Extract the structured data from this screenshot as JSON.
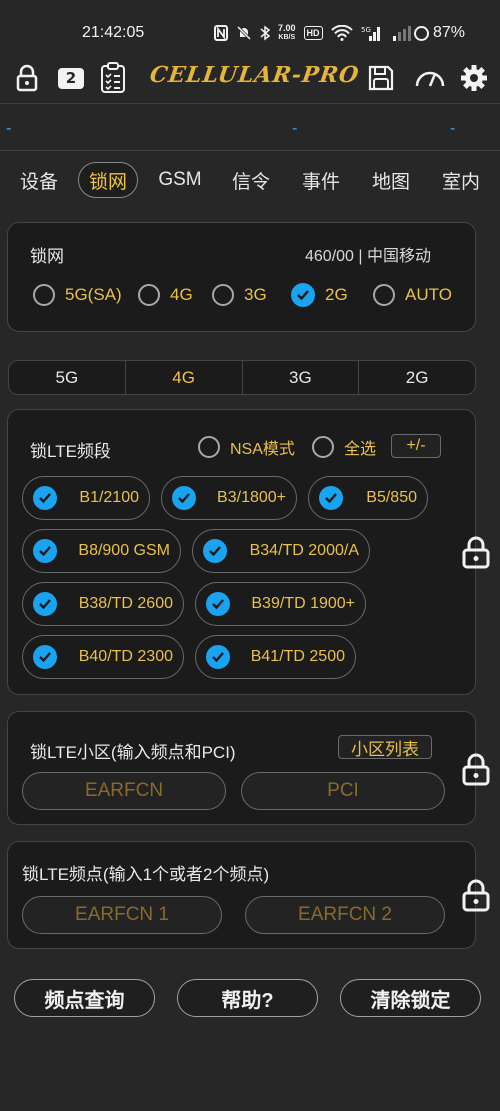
{
  "status_bar": {
    "time": "21:42:05",
    "speed_value": "7.00",
    "speed_unit": "KB/S",
    "hd_label": "HD",
    "battery": "87%"
  },
  "toolbar": {
    "badge_count": "2",
    "app_title": "CELLULAR-PRO"
  },
  "info_dashes": [
    "-",
    "-",
    "-"
  ],
  "tabs": [
    "设备",
    "锁网",
    "GSM",
    "信令",
    "事件",
    "地图",
    "室内"
  ],
  "active_tab": "锁网",
  "lock_network": {
    "title": "锁网",
    "operator": "460/00 | 中国移动",
    "options": [
      "5G(SA)",
      "4G",
      "3G",
      "2G",
      "AUTO"
    ],
    "selected": "2G"
  },
  "rat_tabs": [
    "5G",
    "4G",
    "3G",
    "2G"
  ],
  "rat_selected": "4G",
  "band_lock": {
    "title": "锁LTE频段",
    "nsa_label": "NSA模式",
    "select_all_label": "全选",
    "plus_minus_label": "+/-",
    "bands": [
      "B1/2100",
      "B3/1800+",
      "B5/850",
      "B8/900 GSM",
      "B34/TD 2000/A",
      "B38/TD 2600",
      "B39/TD 1900+",
      "B40/TD 2300",
      "B41/TD 2500"
    ]
  },
  "cell_lock": {
    "title": "锁LTE小区(输入频点和PCI)",
    "cell_list_label": "小区列表",
    "earfcn_placeholder": "EARFCN",
    "pci_placeholder": "PCI"
  },
  "freq_lock": {
    "title": "锁LTE频点(输入1个或者2个频点)",
    "earfcn1_placeholder": "EARFCN 1",
    "earfcn2_placeholder": "EARFCN 2"
  },
  "buttons": {
    "query": "频点查询",
    "help": "帮助?",
    "clear": "清除锁定"
  },
  "colors": {
    "background": "#272727",
    "accent_gold": "#e8c04a",
    "check_blue": "#1aa3f0"
  }
}
